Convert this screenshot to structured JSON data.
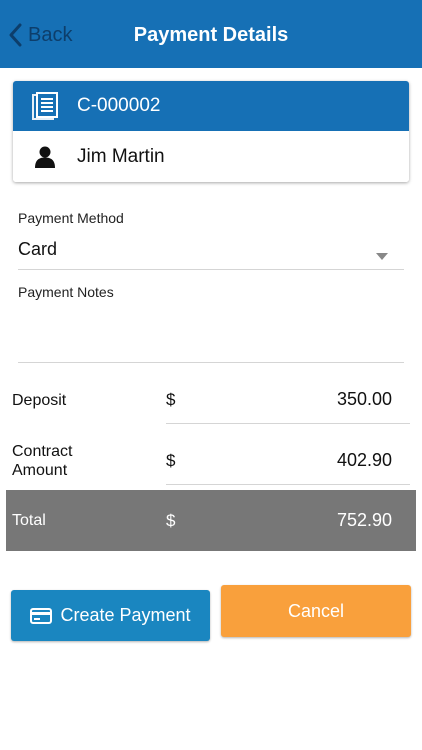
{
  "nav": {
    "back_label": "Back",
    "title": "Payment Details"
  },
  "record": {
    "contract_id": "C-000002",
    "customer_name": "Jim Martin"
  },
  "form": {
    "payment_method_label": "Payment Method",
    "payment_method_value": "Card",
    "payment_notes_label": "Payment Notes",
    "payment_notes_value": ""
  },
  "summary": {
    "currency_symbol": "$",
    "deposit_label": "Deposit",
    "deposit_amount": "350.00",
    "contract_label_line1": "Contract",
    "contract_label_line2": "Amount",
    "contract_amount": "402.90",
    "total_label": "Total",
    "total_amount": "752.90"
  },
  "actions": {
    "create_label": "Create Payment",
    "cancel_label": "Cancel"
  },
  "icons": {
    "back": "chevron-left-icon",
    "contract": "document-icon",
    "customer": "person-icon",
    "dropdown": "caret-down-icon",
    "card": "credit-card-icon"
  },
  "colors": {
    "primary": "#1670b5",
    "create_button": "#1a86c0",
    "cancel_button": "#f9a03c",
    "total_bar": "#777777"
  }
}
